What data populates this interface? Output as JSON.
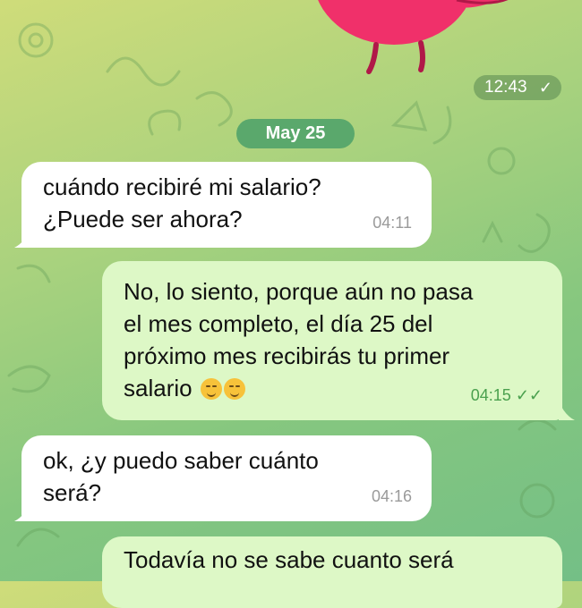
{
  "sticker": {
    "time": "12:43",
    "status_icon": "single-check-icon"
  },
  "date_separator": "May 25",
  "messages": [
    {
      "side": "in",
      "text": "cuándo recibiré mi salario?\n¿Puede ser ahora?",
      "time": "04:11"
    },
    {
      "side": "out",
      "text": "No, lo siento, porque aún no pasa\nel mes completo, el día 25 del\npróximo mes recibirás tu primer\nsalario",
      "time": "04:15",
      "status_icon": "double-check-icon"
    },
    {
      "side": "in",
      "text": "ok, ¿y puedo saber cuánto\nserá?",
      "time": "04:16"
    },
    {
      "side": "out",
      "text": "Todavía no se sabe cuanto será",
      "time": ""
    }
  ],
  "colors": {
    "incoming_bubble": "#ffffff",
    "outgoing_bubble": "#ddf8c6",
    "date_pill": "#5aa86c",
    "sticker": "#f0306a"
  }
}
